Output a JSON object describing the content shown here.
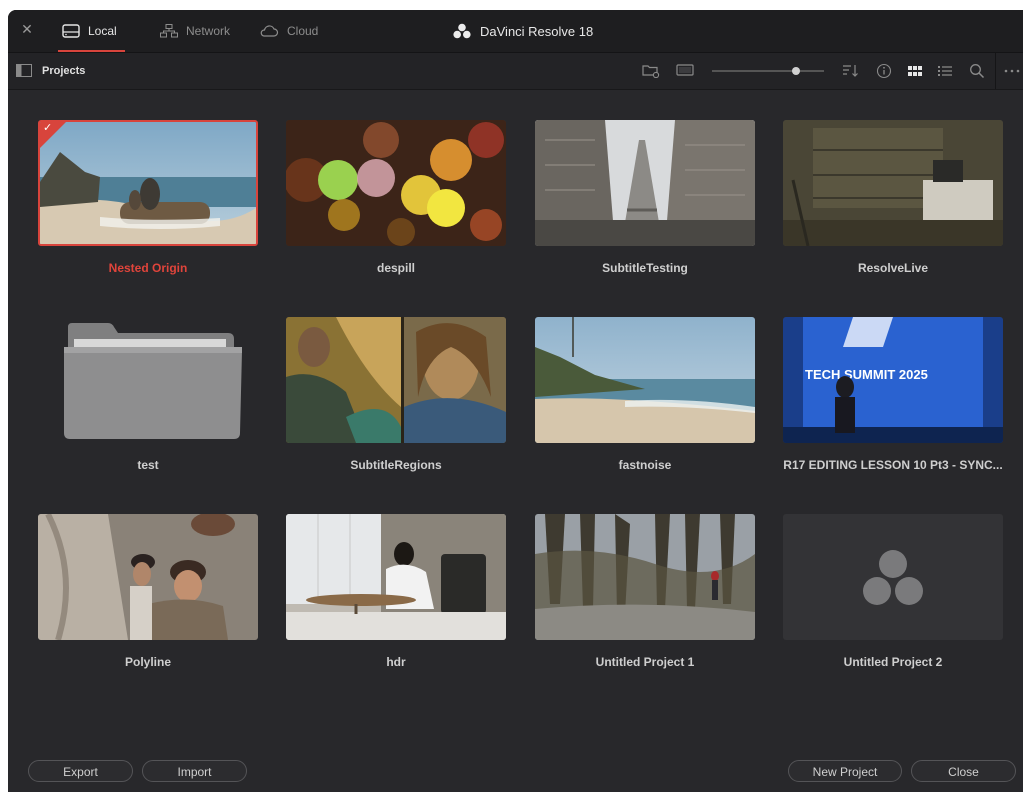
{
  "app": {
    "title": "DaVinci Resolve 18",
    "logo_icon": "davinci-resolve-logo"
  },
  "tabs": [
    {
      "label": "Local",
      "icon": "hard-drive-icon",
      "active": true
    },
    {
      "label": "Network",
      "icon": "network-icon",
      "active": false
    },
    {
      "label": "Cloud",
      "icon": "cloud-icon",
      "active": false
    }
  ],
  "toolbar": {
    "title": "Projects",
    "icons": [
      "new-folder-icon",
      "screen-icon",
      "sort-icon",
      "info-icon",
      "grid-view-icon",
      "list-view-icon",
      "search-icon",
      "more-icon"
    ],
    "thumbnail_size": 0.75
  },
  "projects": [
    {
      "name": "Nested Origin",
      "selected": true,
      "kind": "beach"
    },
    {
      "name": "despill",
      "selected": false,
      "kind": "bokeh"
    },
    {
      "name": "SubtitleTesting",
      "selected": false,
      "kind": "eiffel"
    },
    {
      "name": "ResolveLive",
      "selected": false,
      "kind": "room"
    },
    {
      "name": "test",
      "selected": false,
      "kind": "folder"
    },
    {
      "name": "SubtitleRegions",
      "selected": false,
      "kind": "split"
    },
    {
      "name": "fastnoise",
      "selected": false,
      "kind": "coast"
    },
    {
      "name": "R17 EDITING LESSON 10 Pt3 - SYNC...",
      "selected": false,
      "kind": "stage",
      "overlay_text": "TECH SUMMIT 2025"
    },
    {
      "name": "Polyline",
      "selected": false,
      "kind": "pirates"
    },
    {
      "name": "hdr",
      "selected": false,
      "kind": "interior"
    },
    {
      "name": "Untitled Project 1",
      "selected": false,
      "kind": "forest"
    },
    {
      "name": "Untitled Project 2",
      "selected": false,
      "kind": "placeholder"
    }
  ],
  "footer": {
    "export_label": "Export",
    "import_label": "Import",
    "new_project_label": "New Project",
    "close_label": "Close"
  },
  "colors": {
    "accent": "#d8443c",
    "window_bg": "#28282b",
    "titlebar_bg": "#1e1e20"
  }
}
